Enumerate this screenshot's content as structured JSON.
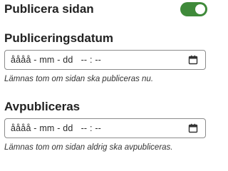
{
  "publish": {
    "label": "Publicera sidan",
    "toggle_on": true,
    "toggle_color": "#3f8a3a"
  },
  "publish_date": {
    "label": "Publiceringsdatum",
    "placeholder": "åååå - mm - dd   -- : --",
    "icon": "calendar-icon",
    "hint": "Lämnas tom om sidan ska publiceras nu."
  },
  "unpublish_date": {
    "label": "Avpubliceras",
    "placeholder": "åååå - mm - dd   -- : --",
    "icon": "calendar-icon",
    "hint": "Lämnas tom om sidan aldrig ska avpubliceras."
  }
}
